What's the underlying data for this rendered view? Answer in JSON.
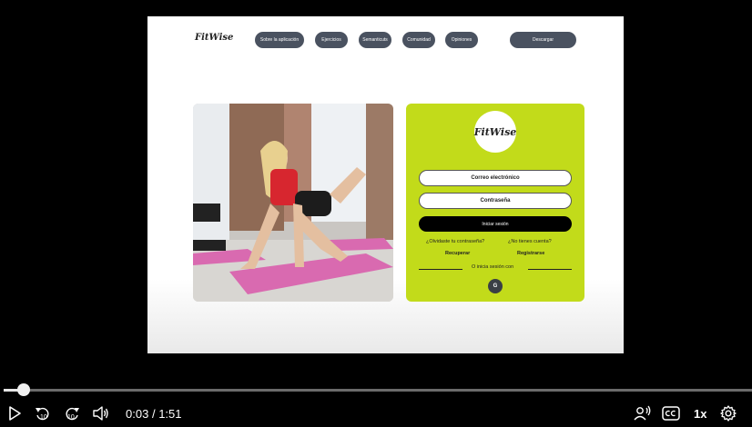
{
  "site": {
    "logo": "FitWise",
    "nav": [
      "Sobre la aplicación",
      "Ejercicios",
      "Semanticuts",
      "Comunidad",
      "Opiniones"
    ],
    "download_label": "Descargar"
  },
  "login": {
    "badge": "FitWise",
    "email_label": "Correo electrónico",
    "password_label": "Contraseña",
    "submit_label": "Iniciar sesión",
    "forgot_text": "¿Olvidaste tu contraseña?",
    "no_account_text": "¿No tienes cuenta?",
    "recover_label": "Recuperar",
    "register_label": "Registrarse",
    "or_text": "O inicia sesión con",
    "google_label": "G"
  },
  "player": {
    "current_time": "0:03",
    "separator": "/",
    "duration": "1:51",
    "speed": "1x",
    "progress_fraction": 0.027,
    "rewind_seconds": "10",
    "forward_seconds": "10"
  },
  "colors": {
    "accent_green": "#c2db1a",
    "nav_pill": "#4a5260",
    "player_bg": "#000000"
  }
}
